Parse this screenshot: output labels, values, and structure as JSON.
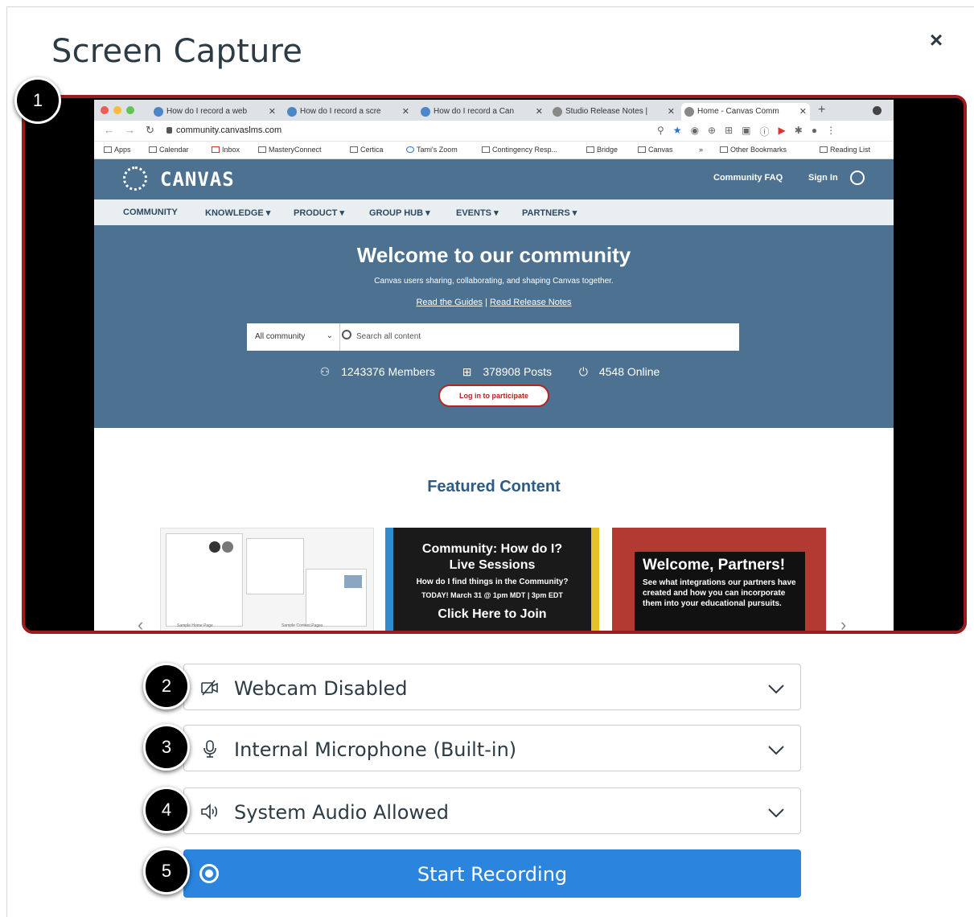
{
  "modal": {
    "title": "Screen Capture",
    "close_symbol": "×"
  },
  "browser": {
    "tabs": [
      {
        "label": "How do I record a web"
      },
      {
        "label": "How do I record a scre"
      },
      {
        "label": "How do I record a Can"
      },
      {
        "label": "Studio Release Notes |"
      },
      {
        "label": "Home - Canvas Comm"
      }
    ],
    "url": "community.canvaslms.com",
    "bookmarks": [
      "Apps",
      "Calendar",
      "Inbox",
      "MasteryConnect",
      "Certica",
      "Tami's Zoom",
      "Contingency Resp...",
      "Bridge",
      "Canvas",
      "»",
      "Other Bookmarks",
      "Reading List"
    ]
  },
  "site": {
    "logo_text": "CANVAS",
    "faq": "Community FAQ",
    "sign_in": "Sign In",
    "nav": [
      "COMMUNITY",
      "KNOWLEDGE ▾",
      "PRODUCT ▾",
      "GROUP HUB ▾",
      "EVENTS ▾",
      "PARTNERS ▾"
    ],
    "hero_title": "Welcome to our community",
    "hero_sub": "Canvas users sharing, collaborating, and shaping Canvas together.",
    "link_guides": "Read the Guides",
    "link_sep": " | ",
    "link_notes": "Read Release Notes",
    "search_scope": "All community",
    "search_placeholder": "Search all content",
    "stat_members": "1243376 Members",
    "stat_posts": "378908 Posts",
    "stat_online": "4548 Online",
    "login": "Log in to participate",
    "featured": "Featured Content",
    "card1_caption_a": "Sample Home Page",
    "card1_caption_b": "Sample Content Pages",
    "card2": [
      "Community: How do I?",
      "Live Sessions",
      "How do I find things in the Community?",
      "TODAY! March 31 @ 1pm MDT | 3pm EDT",
      "Click Here to Join"
    ],
    "card3_title": "Welcome, Partners!",
    "card3_body": "See what integrations our partners have created and how you can incorporate them into your educational pursuits."
  },
  "badges": [
    "1",
    "2",
    "3",
    "4",
    "5"
  ],
  "controls": {
    "webcam": {
      "label": "Webcam Disabled",
      "icon": "webcam-off-icon"
    },
    "microphone": {
      "label": "Internal Microphone (Built-in)",
      "icon": "microphone-icon"
    },
    "audio": {
      "label": "System Audio Allowed",
      "icon": "speaker-icon"
    },
    "start": {
      "label": "Start Recording",
      "icon": "record-icon"
    }
  },
  "colors": {
    "accent_blue": "#2b84dd",
    "preview_border": "#9b1b1e",
    "canvas_header": "#4c7191"
  }
}
